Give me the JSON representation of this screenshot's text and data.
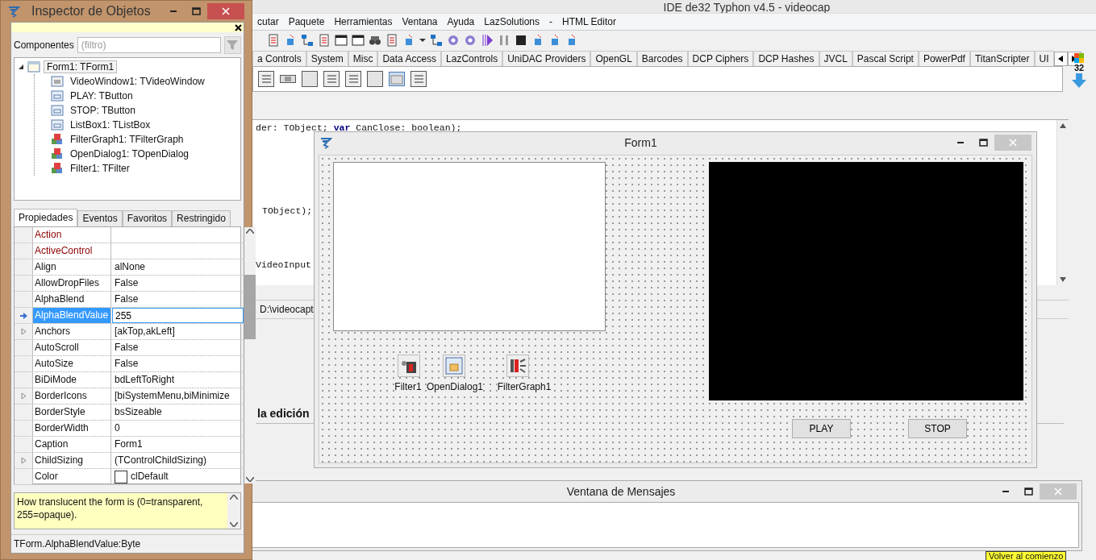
{
  "ide": {
    "title": "IDE de32 Typhon v4.5 - videocap",
    "menu": [
      "cutar",
      "Paquete",
      "Herramientas",
      "Ventana",
      "Ayuda",
      "LazSolutions",
      "-",
      "HTML Editor"
    ],
    "palette_tabs": [
      "a Controls",
      "System",
      "Misc",
      "Data Access",
      "LazControls",
      "UniDAC Providers",
      "OpenGL",
      "Barcodes",
      "DCP Ciphers",
      "DCP Hashes",
      "JVCL",
      "Pascal Script",
      "PowerPdf",
      "TitanScripter",
      "UI"
    ],
    "palette_size": "32",
    "code_lines": [
      "der: TObject; **var** CanClose: boolean);",
      "TObject);",
      "VideoInput"
    ],
    "path": "D:\\videocapt",
    "heading": "la edición",
    "bottom_link": "Volver al comienzo"
  },
  "form": {
    "title": "Form1",
    "components": [
      {
        "label": "Filter1",
        "kind": "filter"
      },
      {
        "label": "OpenDialog1",
        "kind": "dialog"
      },
      {
        "label": "FilterGraph1",
        "kind": "graph"
      }
    ],
    "buttons": [
      "PLAY",
      "STOP"
    ]
  },
  "messages": {
    "title": "Ventana de Mensajes"
  },
  "inspector": {
    "title": "Inspector de Objetos",
    "filter_label": "Componentes",
    "filter_placeholder": "(filtro)",
    "tree": [
      {
        "label": "Form1: TForm1",
        "kind": "form",
        "expanded": true,
        "selected": true,
        "children": [
          {
            "label": "VideoWindow1: TVideoWindow",
            "kind": "video",
            "selected": false
          },
          {
            "label": "PLAY: TButton",
            "kind": "control",
            "selected": false
          },
          {
            "label": "STOP: TButton",
            "kind": "control",
            "selected": false
          },
          {
            "label": "ListBox1: TListBox",
            "kind": "control",
            "selected": false
          },
          {
            "label": "FilterGraph1: TFilterGraph",
            "kind": "component",
            "selected": false
          },
          {
            "label": "OpenDialog1: TOpenDialog",
            "kind": "component",
            "selected": false
          },
          {
            "label": "Filter1: TFilter",
            "kind": "component",
            "selected": false
          }
        ]
      }
    ],
    "tabs": [
      {
        "label": "Propiedades",
        "selected": true
      },
      {
        "label": "Eventos",
        "selected": false
      },
      {
        "label": "Favoritos",
        "selected": false
      },
      {
        "label": "Restringido",
        "selected": false
      }
    ],
    "properties": [
      {
        "name": "Action",
        "kind": "component",
        "expandable": false,
        "selected": false
      },
      {
        "name": "ActiveControl",
        "kind": "component",
        "expandable": false,
        "selected": false
      },
      {
        "name": "Align",
        "value": "alNone",
        "kind": "plain",
        "expandable": false,
        "selected": false
      },
      {
        "name": "AllowDropFiles",
        "value": "False",
        "kind": "plain",
        "expandable": false,
        "selected": false
      },
      {
        "name": "AlphaBlend",
        "value": "False",
        "kind": "plain",
        "expandable": false,
        "selected": false
      },
      {
        "name": "AlphaBlendValue",
        "value": "255",
        "kind": "plain",
        "expandable": false,
        "selected": true
      },
      {
        "name": "Anchors",
        "value": "[akTop,akLeft]",
        "kind": "plain",
        "expandable": true,
        "selected": false
      },
      {
        "name": "AutoScroll",
        "value": "False",
        "kind": "plain",
        "expandable": false,
        "selected": false
      },
      {
        "name": "AutoSize",
        "value": "False",
        "kind": "plain",
        "expandable": false,
        "selected": false
      },
      {
        "name": "BiDiMode",
        "value": "bdLeftToRight",
        "kind": "plain",
        "expandable": false,
        "selected": false
      },
      {
        "name": "BorderIcons",
        "value": "[biSystemMenu,biMinimize",
        "kind": "plain",
        "expandable": true,
        "selected": false
      },
      {
        "name": "BorderStyle",
        "value": "bsSizeable",
        "kind": "plain",
        "expandable": false,
        "selected": false
      },
      {
        "name": "BorderWidth",
        "value": "0",
        "kind": "plain",
        "expandable": false,
        "selected": false
      },
      {
        "name": "Caption",
        "value": "Form1",
        "kind": "plain",
        "expandable": false,
        "selected": false
      },
      {
        "name": "ChildSizing",
        "value": "(TControlChildSizing)",
        "kind": "plain",
        "expandable": true,
        "selected": false
      },
      {
        "name": "Color",
        "value": "clDefault",
        "kind": "color",
        "expandable": false,
        "selected": false
      }
    ],
    "hint": "How translucent the form is (0=transparent, 255=opaque).",
    "status": "TForm.AlphaBlendValue:Byte"
  }
}
